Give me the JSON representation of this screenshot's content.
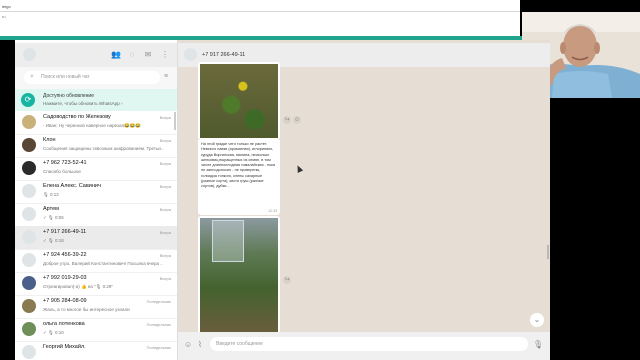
{
  "browser": {
    "line1": "letgo",
    "line2": "ru"
  },
  "left": {
    "search_placeholder": "Поиск или новый чат",
    "notification": {
      "title": "Доступно обновление",
      "subtitle": "Нажмите, чтобы обновить WhatsApp ›"
    },
    "chats": [
      {
        "name": "Садоводство по Железову",
        "preview": "- Иван: Ну черенков наверное нарезал😂😂😂",
        "time": "Вчера"
      },
      {
        "name": "Клон",
        "preview": "Сообщения защищены сквозным шифрованием. Третьи...",
        "time": "Вчера"
      },
      {
        "name": "+7 962 723-52-41",
        "preview": "Спасибо большое",
        "time": "Вчера"
      },
      {
        "name": "Елена Алекс. Савинич",
        "preview": "🎙 0:12",
        "time": "Вчера"
      },
      {
        "name": "Артем",
        "preview": "✓ 🎙 0:06",
        "time": "Вчера"
      },
      {
        "name": "+7 917 266-49-11",
        "preview": "✓ 🎙 0:18",
        "time": "Вчера"
      },
      {
        "name": "+7 924 456-39-22",
        "preview": "Доброе утро, Валерий Константинович! Посылка вчера ...",
        "time": "Вчера"
      },
      {
        "name": "+7 992 019-29-03",
        "preview": "Отреагировал(-а) 👍 на \"🎙 0:29\"",
        "time": "Вчера"
      },
      {
        "name": "+7 905 284-08-09",
        "preview": "Жаль, а то многое бы интересное узнали",
        "time": "Понедельник"
      },
      {
        "name": "ольга лотенкова",
        "preview": "✓ 🎙 0:10",
        "time": "Понедельник"
      },
      {
        "name": "Георгий Михайл.",
        "preview": "",
        "time": "Понедельник"
      }
    ]
  },
  "right": {
    "contact": "+7 917 266-49-11",
    "message_text": "На этой грядке чего только не растет. Немного лавзи (ароматная), иглориниих, куруда Виргинская, малина, несколько шелковиц выращенных из семян, в том числе длинноплодная гималайская - пока не заплодоносил - не проверены, голиадза тонкого, клены сахарные (разные сорта), кисти груш (разные сортов), дубки...",
    "message_time": "12:33",
    "compose_placeholder": "Введите сообщение"
  }
}
